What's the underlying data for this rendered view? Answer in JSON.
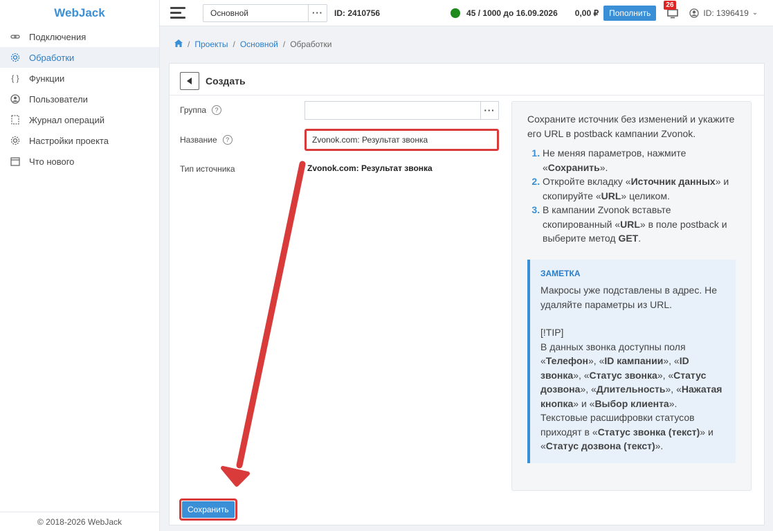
{
  "app": {
    "title": "WebJack",
    "footer": "© 2018-2026 WebJack"
  },
  "sidebar": {
    "items": [
      {
        "label": "Подключения",
        "icon": "link-icon"
      },
      {
        "label": "Обработки",
        "icon": "gear-icon",
        "active": true
      },
      {
        "label": "Функции",
        "icon": "braces-icon"
      },
      {
        "label": "Пользователи",
        "icon": "user-icon"
      },
      {
        "label": "Журнал операций",
        "icon": "journal-icon"
      },
      {
        "label": "Настройки проекта",
        "icon": "settings-icon"
      },
      {
        "label": "Что нового",
        "icon": "window-icon"
      }
    ]
  },
  "topbar": {
    "project": "Основной",
    "project_id": "ID: 2410756",
    "limit": "45 / 1000 до 16.09.2026",
    "balance": "0,00 ₽",
    "topup": "Пополнить",
    "notifications": "26",
    "user_id": "ID: 1396419"
  },
  "breadcrumb": {
    "items": [
      "Проекты",
      "Основной",
      "Обработки"
    ]
  },
  "card": {
    "title": "Создать",
    "group_label": "Группа",
    "name_label": "Название",
    "name_value": "Zvonok.com: Результат звонка",
    "type_label": "Тип источника",
    "type_value": "Zvonok.com: Результат звонка",
    "save": "Сохранить"
  },
  "info": {
    "intro": "Сохраните источник без изменений и укажите его URL в postback кампании Zvonok.",
    "note_title": "ЗАМЕТКА",
    "note_text": "Макросы уже подставлены в адрес. Не удаляйте параметры из URL.",
    "tip": "[!TIP]"
  },
  "colors": {
    "accent": "#3a8fd6",
    "highlight": "#d93a3a",
    "status": "#1e8a1e"
  }
}
